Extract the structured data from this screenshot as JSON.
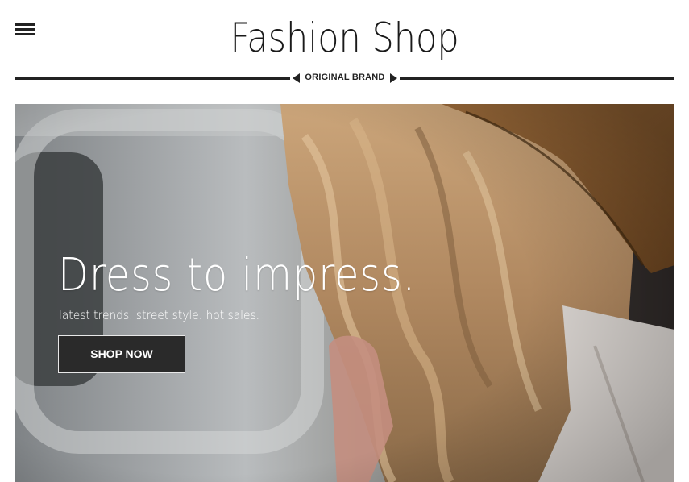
{
  "header": {
    "menu_icon": "hamburger-menu-icon",
    "logo_text": "Fashion Shop",
    "tagline": "ORIGINAL BRAND"
  },
  "hero": {
    "title": "Dress to impress.",
    "subtitle": "latest trends. street style. hot sales.",
    "cta_label": "SHOP NOW",
    "image_alt": "woman with long wavy blonde hair wearing a straw hat"
  },
  "colors": {
    "text_dark": "#222222",
    "button_bg": "#2a2a2a",
    "hero_text": "#ffffff"
  }
}
